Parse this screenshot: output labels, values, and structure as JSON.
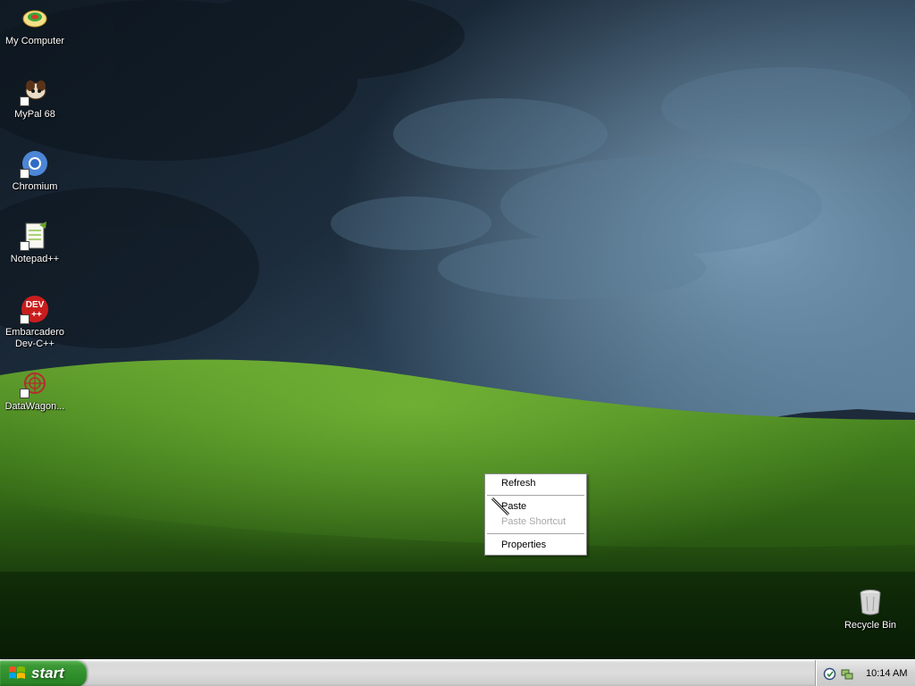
{
  "desktop": {
    "icons": [
      {
        "label": "My Computer",
        "icon": "my-computer-icon"
      },
      {
        "label": "MyPal 68",
        "icon": "mypal-icon"
      },
      {
        "label": "Chromium",
        "icon": "chromium-icon"
      },
      {
        "label": "Notepad++",
        "icon": "notepad-plus-plus-icon"
      },
      {
        "label": "Embarcadero\nDev-C++",
        "icon": "dev-cpp-icon"
      },
      {
        "label": "DataWagon...",
        "icon": "datawagon-icon"
      },
      {
        "label": "Recycle Bin",
        "icon": "recycle-bin-icon"
      }
    ]
  },
  "context_menu": {
    "items": [
      {
        "label": "Refresh",
        "enabled": true
      },
      {
        "label": "Paste",
        "enabled": true
      },
      {
        "label": "Paste Shortcut",
        "enabled": false
      },
      {
        "label": "Properties",
        "enabled": true
      }
    ]
  },
  "taskbar": {
    "start_label": "start",
    "clock": "10:14 AM",
    "tray_icons": [
      "security-shield-icon",
      "network-icon"
    ]
  },
  "colors": {
    "start_green": "#3c9a36",
    "taskbar_gray": "#d9d9d9",
    "menu_disabled": "#a8a8a8"
  }
}
